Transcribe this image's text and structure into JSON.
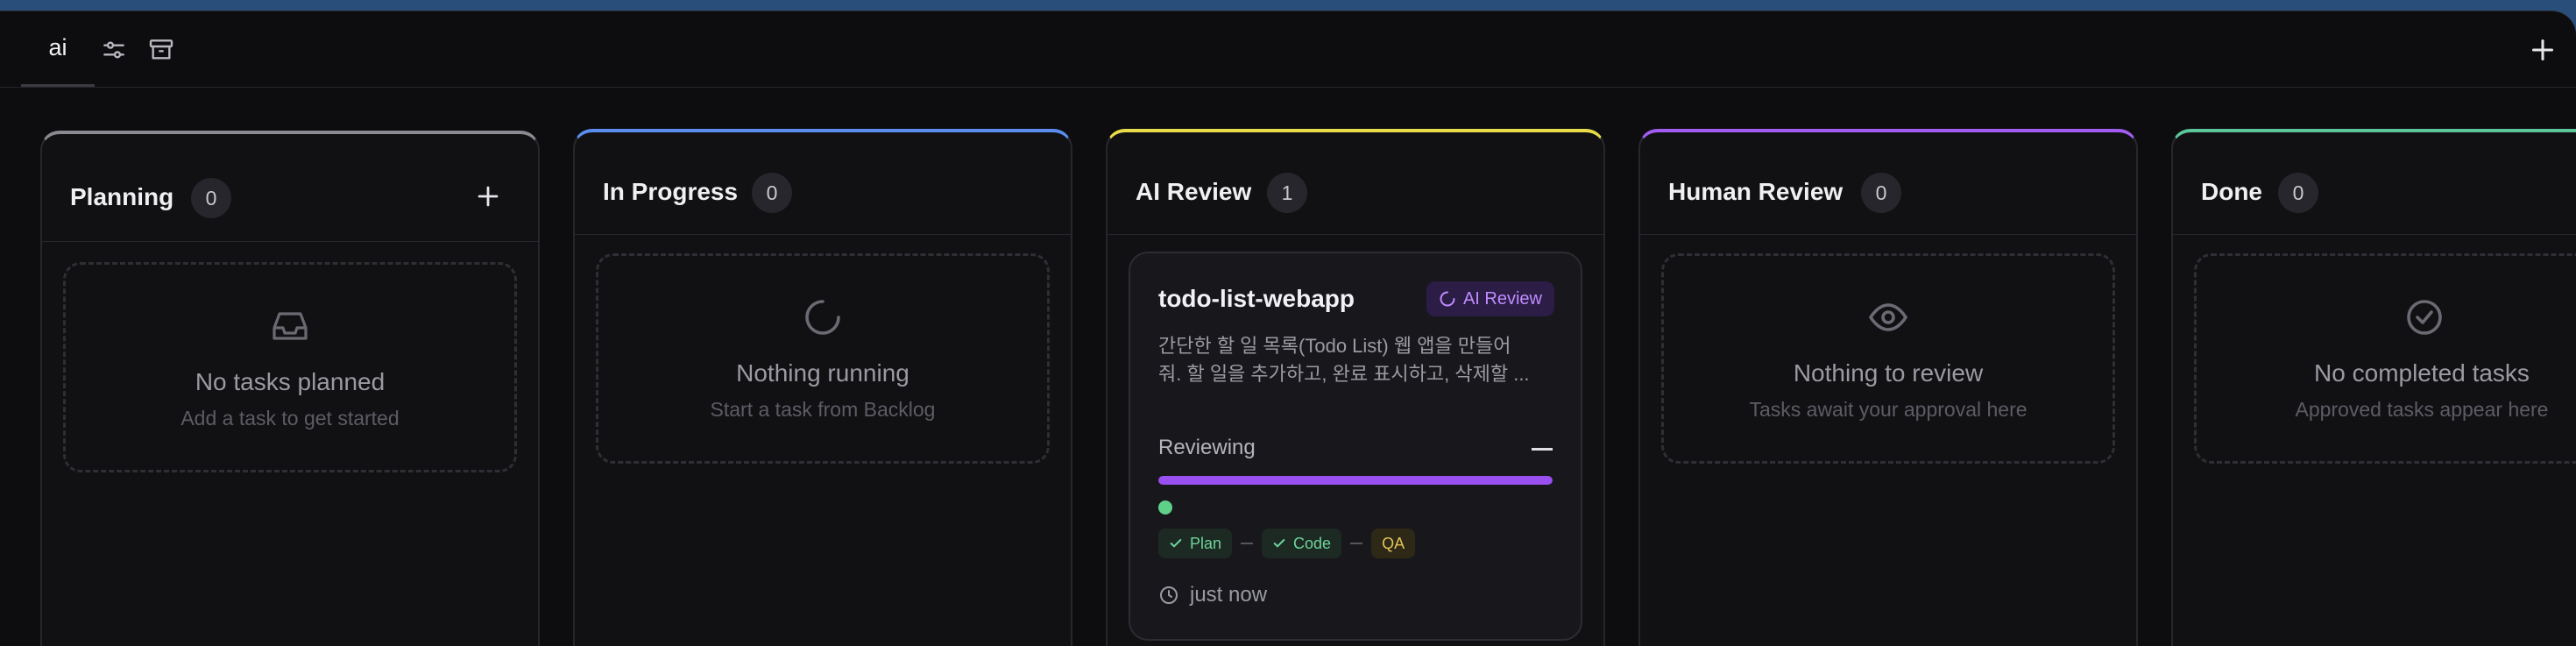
{
  "topbar": {
    "tab_label": "ai",
    "icons": [
      "sliders-icon",
      "archive-icon",
      "plus-icon"
    ]
  },
  "columns": [
    {
      "title": "Planning",
      "count": "0",
      "accent": "#8a8a90",
      "empty_title": "No tasks planned",
      "empty_subtitle": "Add a task to get started",
      "icon": "inbox-icon"
    },
    {
      "title": "In Progress",
      "count": "0",
      "accent": "#5b8def",
      "empty_title": "Nothing running",
      "empty_subtitle": "Start a task from Backlog",
      "icon": "loader-icon"
    },
    {
      "title": "AI Review",
      "count": "1",
      "accent": "#e8dc4a"
    },
    {
      "title": "Human Review",
      "count": "0",
      "accent": "#a35cf0",
      "empty_title": "Nothing to review",
      "empty_subtitle": "Tasks await your approval here",
      "icon": "eye-icon"
    },
    {
      "title": "Done",
      "count": "0",
      "accent": "#5cc59a",
      "empty_title": "No completed tasks",
      "empty_subtitle": "Approved tasks appear here",
      "icon": "check-circle-icon"
    }
  ],
  "task_card": {
    "title": "todo-list-webapp",
    "badge": "AI Review",
    "description_line1": "간단한 할 일 목록(Todo List) 웹 앱을 만들어",
    "description_line2": "줘. 할 일을 추가하고, 완료 표시하고, 삭제할 ...",
    "status": "Reviewing",
    "progress": 1.0,
    "steps": [
      {
        "label": "Plan",
        "state": "done"
      },
      {
        "label": "Code",
        "state": "done"
      },
      {
        "label": "QA",
        "state": "pending"
      }
    ],
    "time": "just now"
  },
  "colors": {
    "background": "#0d0d10",
    "accent_purple": "#9a4ff0",
    "success_green": "#5fd08a",
    "warning_yellow": "#e2c25a"
  }
}
